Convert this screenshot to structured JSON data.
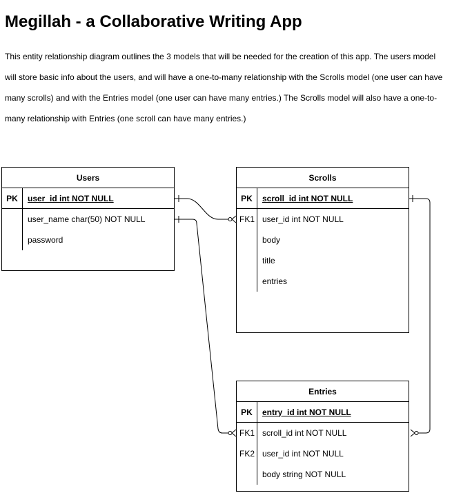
{
  "title": "Megillah - a Collaborative Writing App",
  "intro": "This entity relationship diagram outlines the 3 models that will be needed for the creation of this app. The users model will store basic info about the users, and will have a one-to-many relationship with the Scrolls model (one user can have many scrolls) and with the Entries model (one user can have many entries.) The Scrolls model will also have a one-to-many relationship with Entries (one scroll can have many entries.)",
  "entities": {
    "users": {
      "name": "Users",
      "pk": {
        "key": "PK",
        "attr": "user_id int NOT NULL"
      },
      "fields": [
        {
          "key": "",
          "attr": "user_name char(50) NOT NULL"
        },
        {
          "key": "",
          "attr": "password"
        }
      ]
    },
    "scrolls": {
      "name": "Scrolls",
      "pk": {
        "key": "PK",
        "attr": "scroll_id int NOT NULL"
      },
      "fields": [
        {
          "key": "FK1",
          "attr": "user_id int NOT NULL"
        },
        {
          "key": "",
          "attr": "body"
        },
        {
          "key": "",
          "attr": "title"
        },
        {
          "key": "",
          "attr": "entries"
        }
      ]
    },
    "entries": {
      "name": "Entries",
      "pk": {
        "key": "PK",
        "attr": "entry_id int NOT NULL"
      },
      "fields": [
        {
          "key": "FK1",
          "attr": "scroll_id int NOT NULL"
        },
        {
          "key": "FK2",
          "attr": "user_id int NOT NULL"
        },
        {
          "key": "",
          "attr": "body string NOT NULL"
        }
      ]
    }
  },
  "relationships": [
    {
      "from": "users.user_id",
      "to": "scrolls.user_id",
      "type": "one-to-many"
    },
    {
      "from": "users.user_name",
      "to": "entries.scroll_id",
      "type": "one-to-many"
    },
    {
      "from": "scrolls.scroll_id",
      "to": "entries.scroll_id",
      "type": "one-to-many"
    }
  ]
}
